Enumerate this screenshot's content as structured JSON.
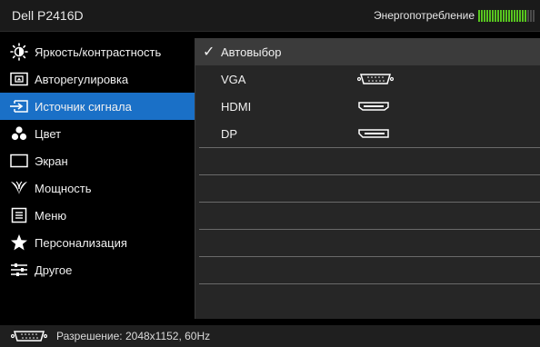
{
  "header": {
    "model": "Dell P2416D",
    "energy_label": "Энергопотребление",
    "energy_level_bars": 18,
    "energy_total_bars": 21
  },
  "menu": {
    "items": [
      {
        "label": "Яркость/контрастность",
        "icon": "brightness-icon"
      },
      {
        "label": "Авторегулировка",
        "icon": "auto-adjust-icon"
      },
      {
        "label": "Источник сигнала",
        "icon": "input-source-icon",
        "active": true
      },
      {
        "label": "Цвет",
        "icon": "color-icon"
      },
      {
        "label": "Экран",
        "icon": "display-icon"
      },
      {
        "label": "Мощность",
        "icon": "power-icon"
      },
      {
        "label": "Меню",
        "icon": "menu-icon"
      },
      {
        "label": "Персонализация",
        "icon": "star-icon"
      },
      {
        "label": "Другое",
        "icon": "other-icon"
      }
    ]
  },
  "panel": {
    "options": [
      {
        "label": "Автовыбор",
        "checked": true,
        "connector": ""
      },
      {
        "label": "VGA",
        "checked": false,
        "connector": "vga-connector-icon"
      },
      {
        "label": "HDMI",
        "checked": false,
        "connector": "hdmi-connector-icon"
      },
      {
        "label": "DP",
        "checked": false,
        "connector": "displayport-connector-icon"
      }
    ],
    "check_mark": "✓"
  },
  "footer": {
    "resolution": "Разрешение: 2048x1152, 60Hz",
    "icon": "vga-connector-icon"
  },
  "colors": {
    "accent": "#1a70c7",
    "energy": "#57c51f"
  }
}
